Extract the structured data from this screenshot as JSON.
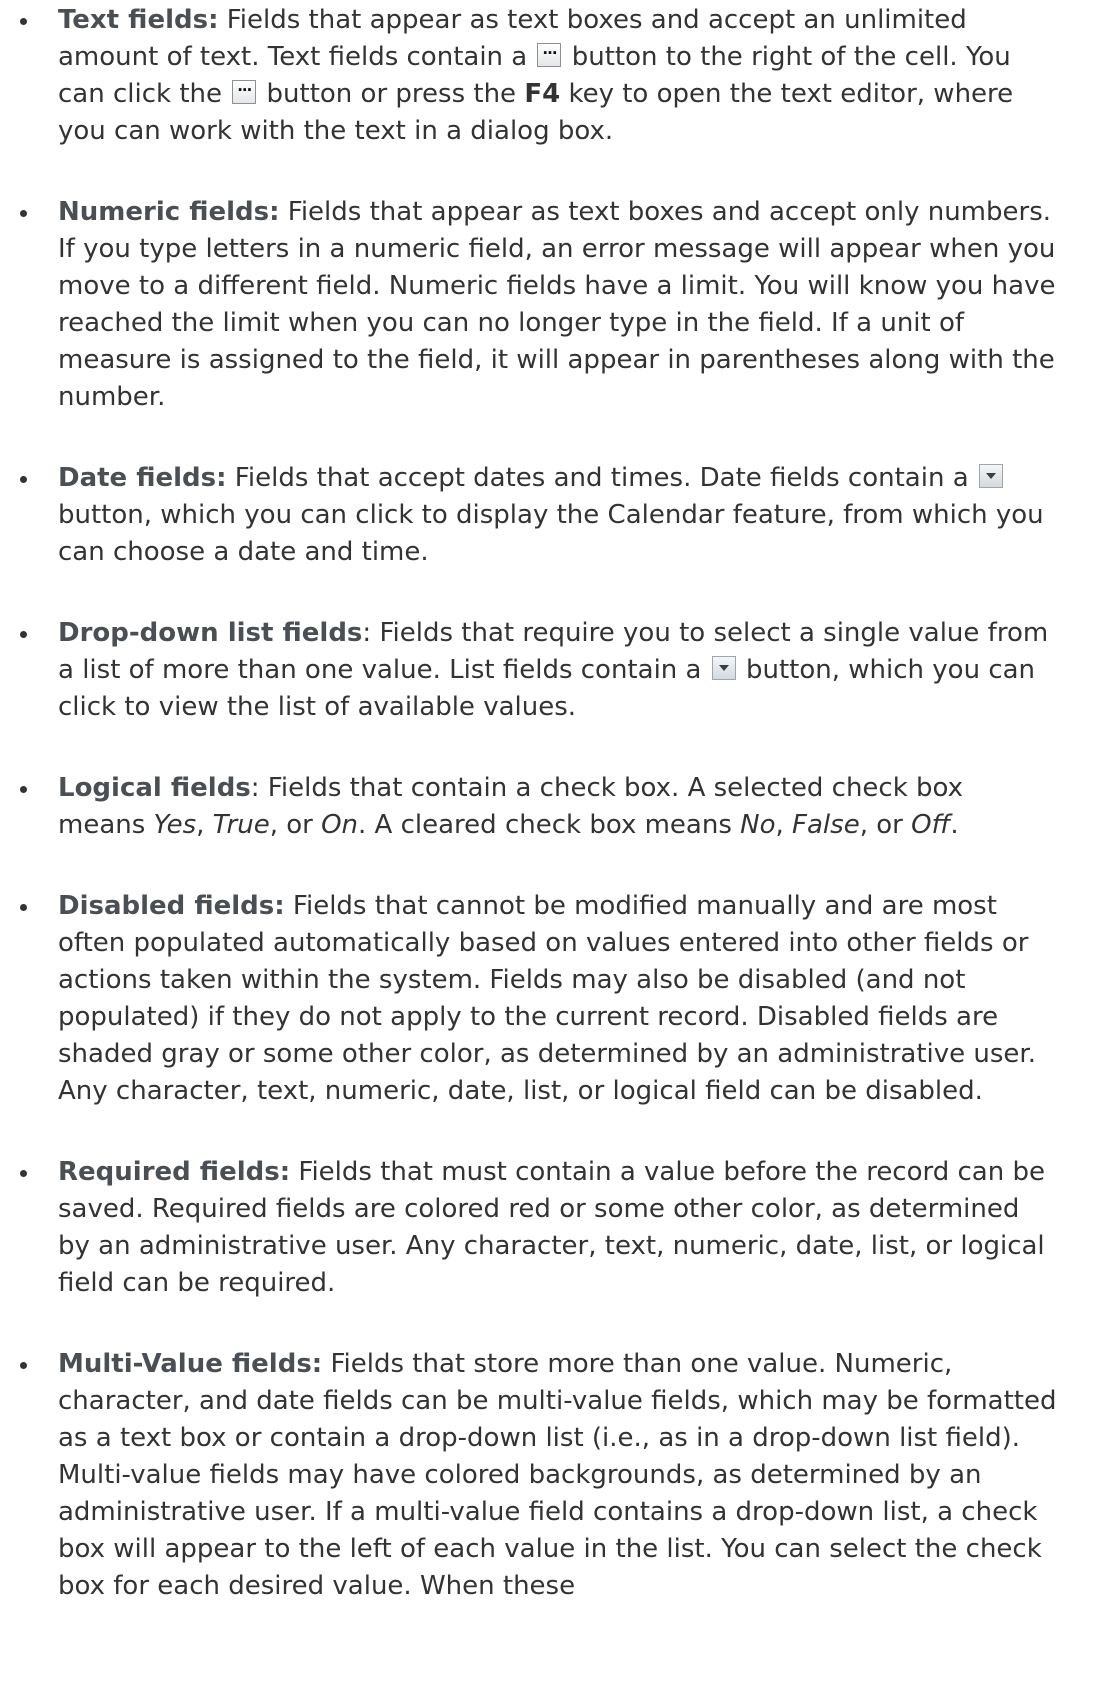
{
  "items": [
    {
      "term": "Text fields:",
      "t1": " Fields that appear as text boxes and accept an unlimited amount of text. Text fields contain a ",
      "t2": " button to the right of the cell. You can click the ",
      "t3": " button or press the ",
      "key": "F4",
      "t4": " key to open the text editor, where you can work with the text in a dialog box.",
      "icon": "ellipsis-button-icon"
    },
    {
      "term": "Numeric fields:",
      "t1": " Fields that appear as text boxes and accept only numbers. If you type letters in a numeric field, an error message will appear when you move to a different field. Numeric fields have a limit. You will know you have reached the limit when you can no longer type in the field. If a unit of measure is assigned to the field, it will appear in parentheses along with the number."
    },
    {
      "term": "Date fields:",
      "t1": " Fields that accept dates and times. Date fields contain a ",
      "t2": " button, which you can click to display the Calendar feature, from which you can choose a date and time.",
      "icon": "dropdown-arrow-icon"
    },
    {
      "term": "Drop-down list fields",
      "t0": ":",
      "t1": " Fields that require you to select a single value from a list of more than one value. List fields contain a ",
      "t2": " button, which you can click to view the list of available values.",
      "icon": "dropdown-arrow-icon"
    },
    {
      "term": "Logical fields",
      "t0": ":",
      "t1": " Fields that contain a check box. A selected check box means ",
      "e1": "Yes",
      "s1": ", ",
      "e2": "True",
      "s2": ", or ",
      "e3": "On",
      "s3": ". A cleared check box means ",
      "e4": "No",
      "s4": ", ",
      "e5": "False",
      "s5": ", or ",
      "e6": "Off",
      "s6": "."
    },
    {
      "term": "Disabled fields:",
      "t1": " Fields that cannot be modified manually and are most often populated automatically based on values entered into other fields or actions taken within the system. Fields may also be disabled (and not populated) if they do not apply to the current record. Disabled fields are shaded gray or some other color, as determined by an administrative user. Any character, text, numeric, date, list, or logical field can be disabled."
    },
    {
      "term": "Required fields:",
      "t1": " Fields that must contain a value before the record can be saved. Required fields are colored red or some other color, as determined by an administrative user. Any character, text, numeric, date, list, or logical field can be required."
    },
    {
      "term": "Multi-Value fields:",
      "t1": " Fields that store more than one value. Numeric, character, and date fields can be multi-value fields, which may be formatted as a text box or contain a drop-down list (i.e., as in a drop-down list field). Multi-value fields may have colored backgrounds, as determined by an administrative user. If a multi-value field contains a drop-down list, a check box will appear to the left of each value in the list. You can select the check box for each desired value. When these"
    }
  ],
  "colors": {
    "term": "#4a4f55",
    "text": "#333333"
  }
}
